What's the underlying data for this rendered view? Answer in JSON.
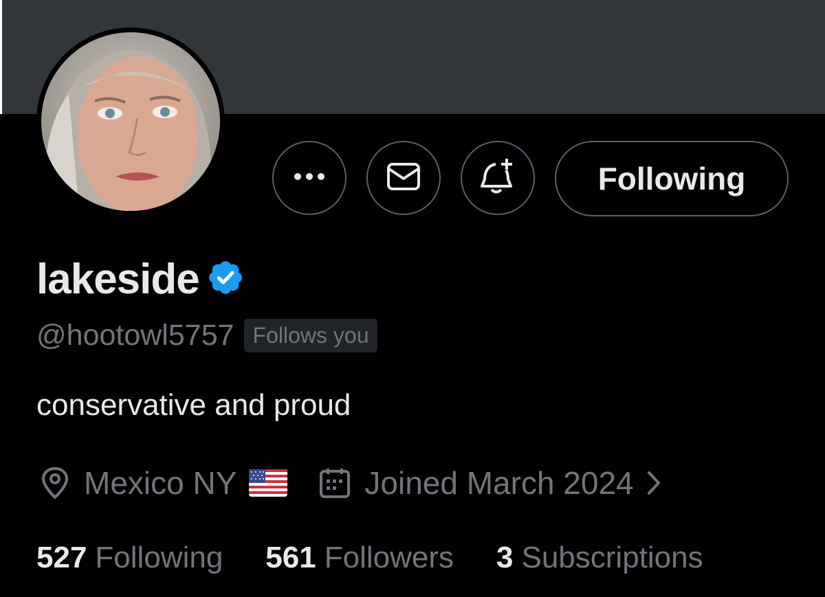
{
  "profile": {
    "display_name": "lakeside",
    "handle": "@hootowl5757",
    "follows_you_badge": "Follows you",
    "bio": "conservative and proud",
    "location": "Mexico NY",
    "joined": "Joined March 2024",
    "verified": true
  },
  "actions": {
    "more_icon": "more-icon",
    "message_icon": "mail-icon",
    "notify_icon": "bell-plus-icon",
    "follow_label": "Following"
  },
  "stats": {
    "following_count": "527",
    "following_label": "Following",
    "followers_count": "561",
    "followers_label": "Followers",
    "subscriptions_count": "3",
    "subscriptions_label": "Subscriptions"
  },
  "colors": {
    "background": "#000000",
    "banner": "#333639",
    "verified_badge": "#1d9bf0",
    "muted_text": "#71767b",
    "primary_text": "#e7e9ea"
  }
}
